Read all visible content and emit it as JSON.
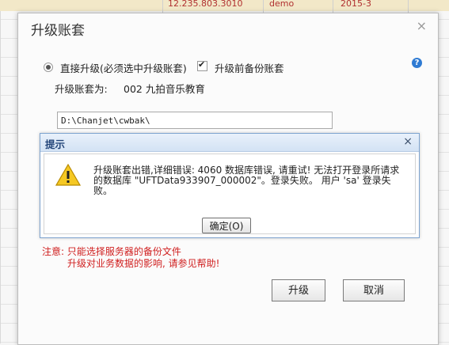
{
  "background": {
    "cells": [
      "12.235.803.3010",
      "demo",
      "2015-3"
    ]
  },
  "upgrade_dialog": {
    "title": "升级账套",
    "close_glyph": "×",
    "direct_upgrade_label": "直接升级(必须选中升级账套)",
    "backup_label": "升级前备份账套",
    "backup_checked": true,
    "help_glyph": "?",
    "target_label": "升级账套为:",
    "target_value": "002 九拍音乐教育",
    "backup_path": "D:\\Chanjet\\cwbak\\",
    "note_line1": "注意: 只能选择服务器的备份文件",
    "note_line2": "升级对业务数据的影响, 请参见帮助!",
    "upgrade_button": "升级",
    "cancel_button": "取消"
  },
  "prompt_dialog": {
    "title": "提示",
    "close_glyph": "×",
    "message": "升级账套出错,详细错误: 4060 数据库错误, 请重试! 无法打开登录所请求的数据库 \"UFTData933907_000002\"。登录失败。 用户 'sa' 登录失败。",
    "ok_button": "确定(O)"
  },
  "colors": {
    "prompt_title": "#24467a",
    "note_red": "#d02020",
    "help_blue": "#2f7bd3"
  }
}
